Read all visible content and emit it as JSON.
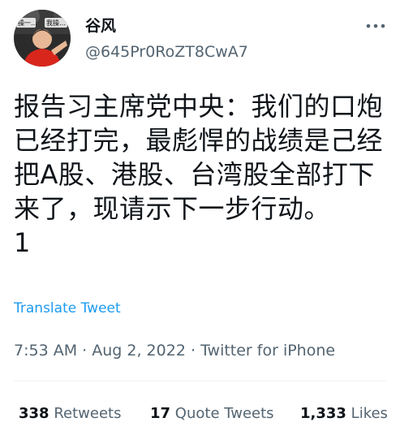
{
  "author": {
    "name": "谷风",
    "handle": "@645Pr0RoZT8CwA7",
    "avatar_text": "操一… 我操…"
  },
  "icons": {
    "more": "more-dots-icon"
  },
  "tweet": {
    "text": "报告习主席党中央：我们的口炮已经打完，最彪悍的战绩是己经把A股、港股、台湾股全部打下来了，现请示下一步行动。\n1",
    "translate_label": "Translate Tweet",
    "time": "7:53 AM",
    "separator": "·",
    "date": "Aug 2, 2022",
    "source": "Twitter for iPhone"
  },
  "stats": {
    "retweets_count": "338",
    "retweets_label": "Retweets",
    "quotes_count": "17",
    "quotes_label": "Quote Tweets",
    "likes_count": "1,333",
    "likes_label": "Likes"
  },
  "colors": {
    "link": "#1d9bf0",
    "secondary_text": "#536471",
    "primary_text": "#0f1419",
    "divider": "#eff3f4"
  }
}
